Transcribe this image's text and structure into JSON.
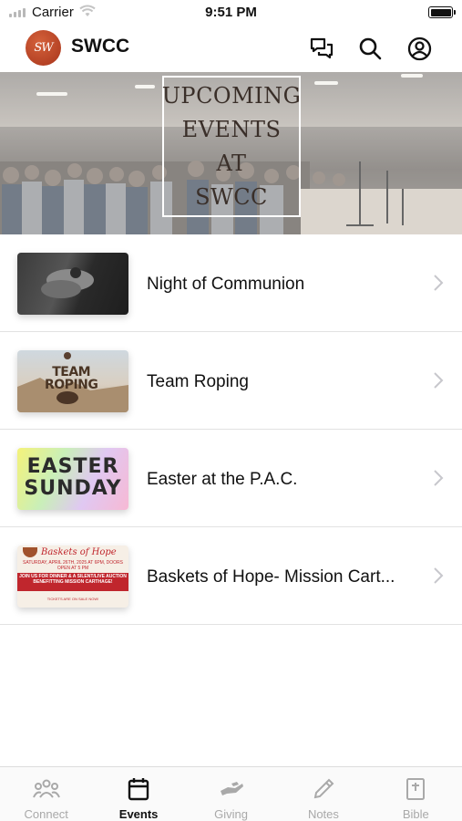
{
  "status_bar": {
    "carrier": "Carrier",
    "time": "9:51 PM"
  },
  "header": {
    "logo_text": "SW",
    "title": "SWCC",
    "icons": [
      "chat-icon",
      "search-icon",
      "account-icon"
    ]
  },
  "banner": {
    "lines": [
      "UPCOMING",
      "EVENTS",
      "AT",
      "SWCC"
    ]
  },
  "events": [
    {
      "title": "Night of Communion",
      "thumb": "communion"
    },
    {
      "title": "Team Roping",
      "thumb": "roping",
      "thumb_text": [
        "TEAM",
        "ROPING"
      ]
    },
    {
      "title": "Easter at the P.A.C.",
      "thumb": "easter",
      "thumb_text": [
        "EASTER",
        "SUNDAY"
      ]
    },
    {
      "title": "Baskets of Hope- Mission Cart...",
      "thumb": "baskets",
      "thumb_text": {
        "title": "Baskets of Hope",
        "date": "SATURDAY, APRIL 26TH, 2025 AT 6PM, DOORS OPEN AT 5 PM",
        "band": "JOIN US FOR DINNER & A SILENT/LIVE AUCTION BENEFITTING MISSION CARTHAGE!",
        "foot": "TICKETS ARE ON SALE NOW!"
      }
    }
  ],
  "tabs": [
    {
      "label": "Connect",
      "icon": "people-icon",
      "active": false
    },
    {
      "label": "Events",
      "icon": "calendar-icon",
      "active": true
    },
    {
      "label": "Giving",
      "icon": "giving-hand-icon",
      "active": false
    },
    {
      "label": "Notes",
      "icon": "pencil-icon",
      "active": false
    },
    {
      "label": "Bible",
      "icon": "bible-icon",
      "active": false
    }
  ],
  "colors": {
    "brand": "#b8401f",
    "tab_active": "#111111",
    "tab_inactive": "#a9a9a9",
    "divider": "#e2e2e2"
  }
}
